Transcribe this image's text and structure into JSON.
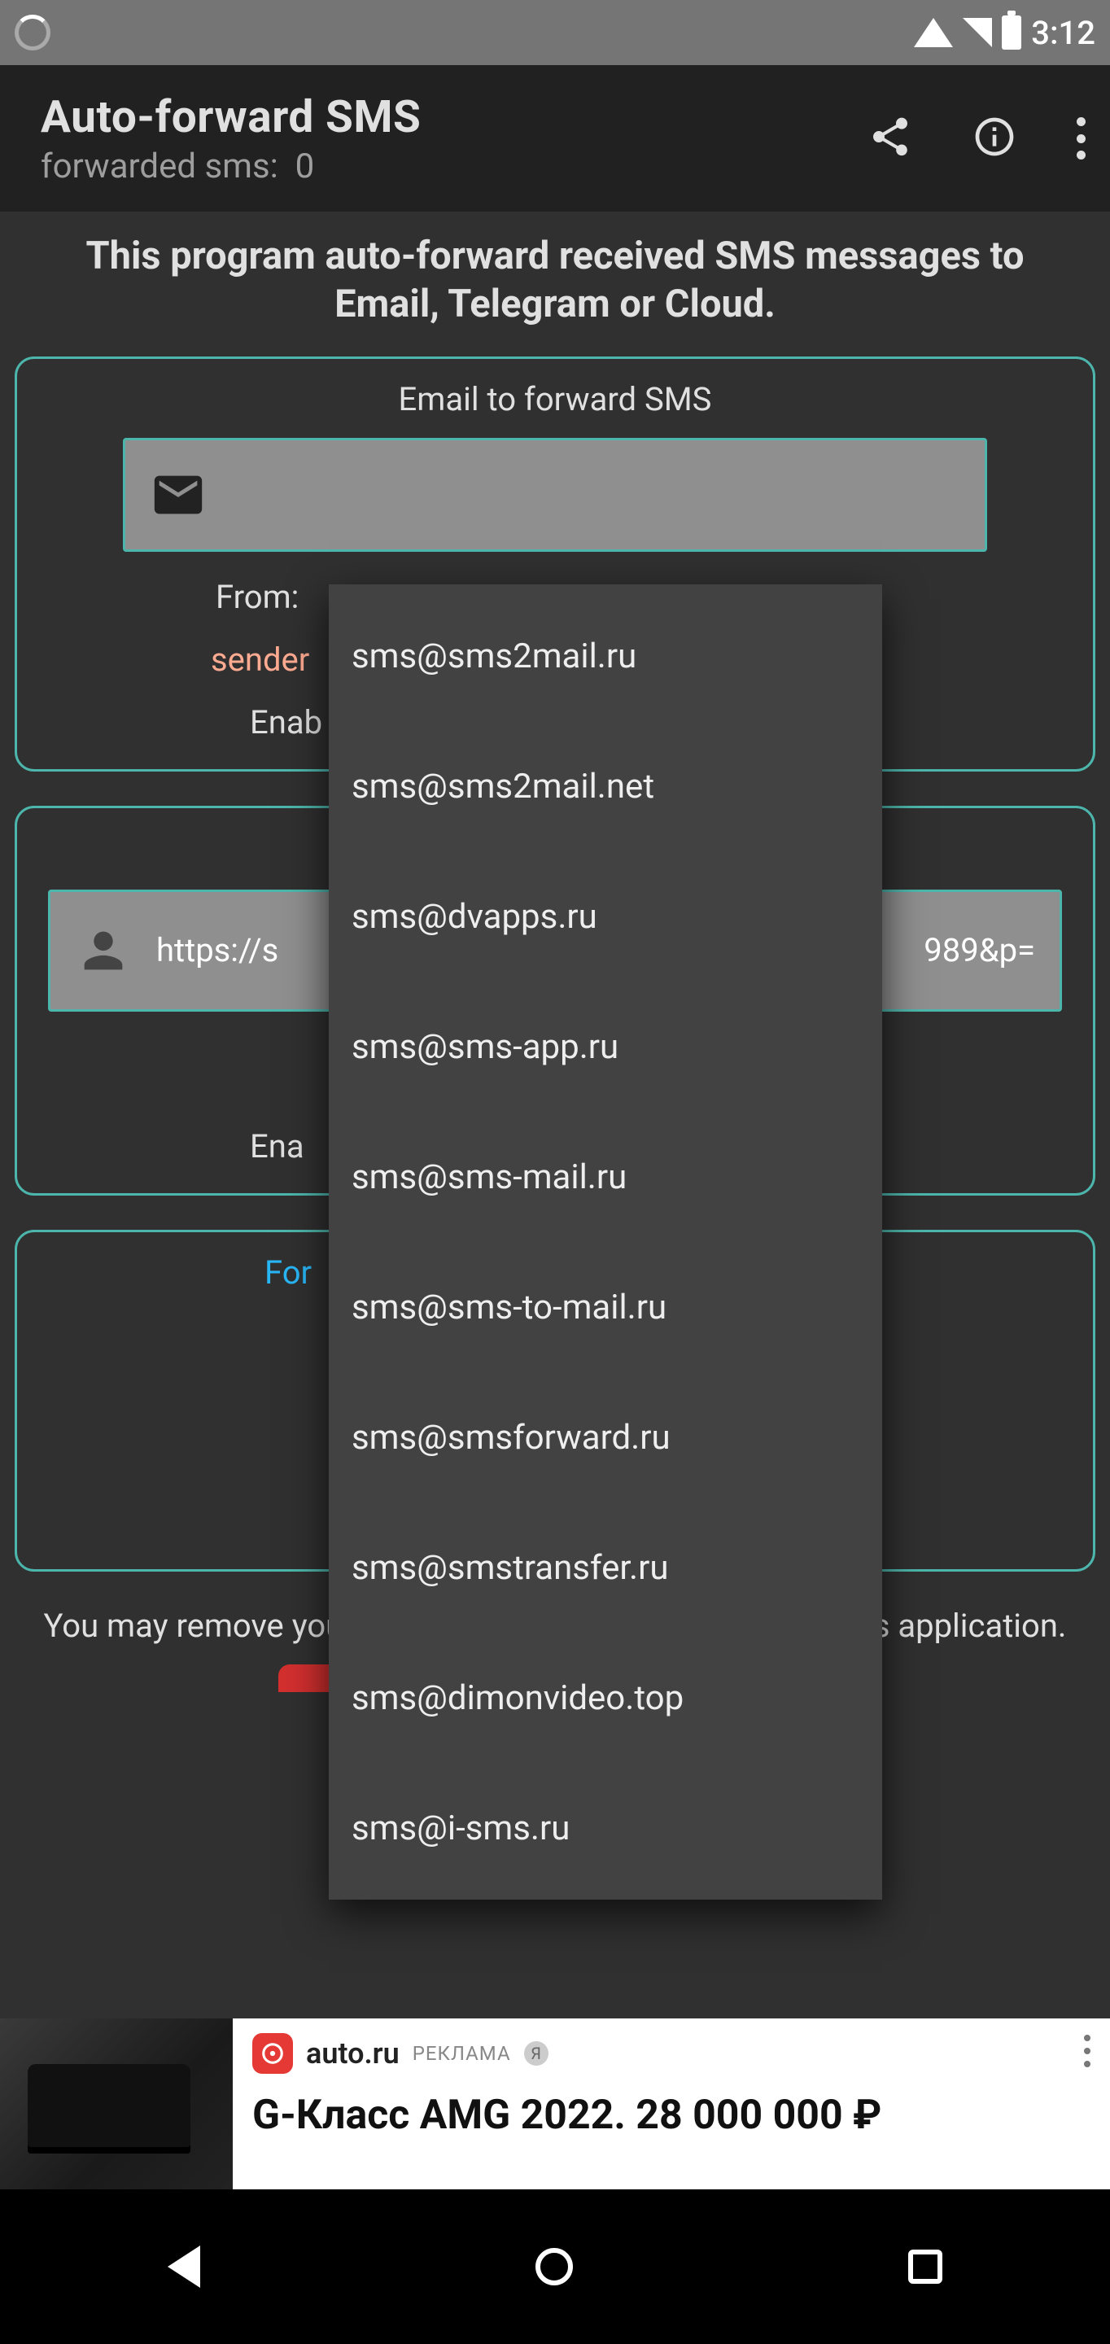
{
  "statusbar": {
    "time": "3:12"
  },
  "appbar": {
    "title": "Auto-forward SMS",
    "subtitle_prefix": "forwarded sms:",
    "forwarded_count": "0"
  },
  "hero": "This program auto-forward received SMS messages to Email, Telegram or Cloud.",
  "panel_email": {
    "title": "Email to forward SMS",
    "from_label": "From:",
    "sender": "sender",
    "enable_label": "Enab"
  },
  "panel_cloud": {
    "url_fragment_left": "https://s",
    "url_fragment_right": "989&p=",
    "enable_label": "Ena"
  },
  "panel_three": {
    "for_label": "For"
  },
  "remove_note": "You may remove your cloud page, if you don't wish use this application.",
  "dropdown": {
    "items": [
      "sms@sms2mail.ru",
      "sms@sms2mail.net",
      "sms@dvapps.ru",
      "sms@sms-app.ru",
      "sms@sms-mail.ru",
      "sms@sms-to-mail.ru",
      "sms@smsforward.ru",
      "sms@smstransfer.ru",
      "sms@dimonvideo.top",
      "sms@i-sms.ru"
    ]
  },
  "ad": {
    "site": "auto.ru",
    "tag": "РЕКЛАМА",
    "ya": "Я",
    "headline": "G-Класс AMG 2022. 28 000 000 ₽"
  }
}
